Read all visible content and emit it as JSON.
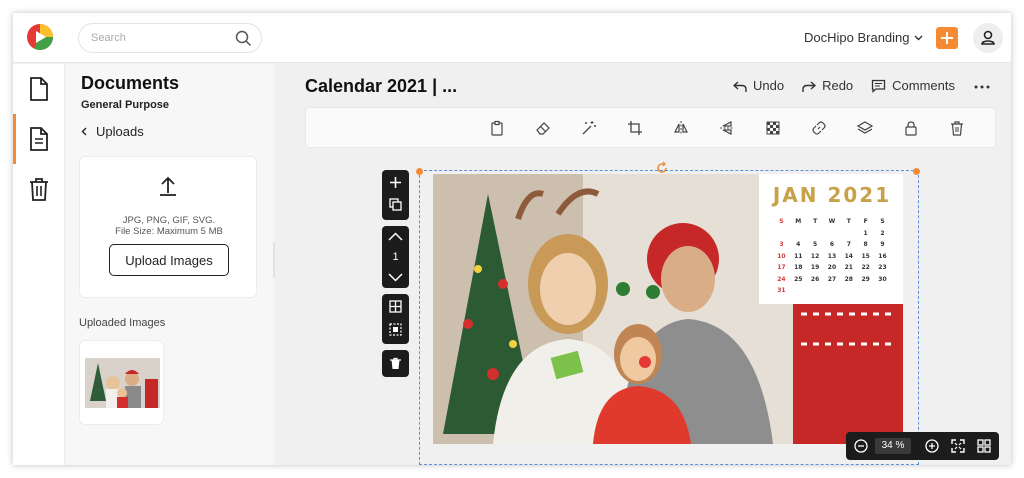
{
  "header": {
    "search_placeholder": "Search",
    "brand_label": "DocHipo Branding",
    "accent_color": "#f58a33"
  },
  "rail": {
    "items": [
      {
        "icon": "document-icon",
        "active": false
      },
      {
        "icon": "file-text-icon",
        "active": true
      },
      {
        "icon": "trash-icon",
        "active": false
      }
    ]
  },
  "panel": {
    "title": "Documents",
    "subtitle": "General Purpose",
    "back_label": "Uploads",
    "upload_types": "JPG, PNG, GIF, SVG.",
    "upload_size": "File Size: Maximum 5 MB",
    "upload_button": "Upload Images",
    "uploaded_label": "Uploaded Images"
  },
  "editor": {
    "doc_title": "Calendar 2021 | ...",
    "undo": "Undo",
    "redo": "Redo",
    "comments": "Comments",
    "page_number": "1",
    "zoom": "34",
    "zoom_unit": "%",
    "toolbar_icons": [
      "clipboard-icon",
      "eraser-icon",
      "magic-wand-icon",
      "crop-icon",
      "flip-horizontal-icon",
      "flip-vertical-icon",
      "transparency-icon",
      "link-icon",
      "layers-icon",
      "lock-icon",
      "delete-icon"
    ]
  },
  "calendar": {
    "month": "JAN 2021",
    "weekdays": [
      "S",
      "M",
      "T",
      "W",
      "T",
      "F",
      "S"
    ],
    "weeks": [
      [
        "",
        "",
        "",
        "",
        "",
        "1",
        "2"
      ],
      [
        "3",
        "4",
        "5",
        "6",
        "7",
        "8",
        "9"
      ],
      [
        "10",
        "11",
        "12",
        "13",
        "14",
        "15",
        "16"
      ],
      [
        "17",
        "18",
        "19",
        "20",
        "21",
        "22",
        "23"
      ],
      [
        "24",
        "25",
        "26",
        "27",
        "28",
        "29",
        "30"
      ],
      [
        "31",
        "",
        "",
        "",
        "",
        "",
        ""
      ]
    ],
    "sunday_color": "#d23a3a",
    "month_color": "#c8a14b"
  }
}
